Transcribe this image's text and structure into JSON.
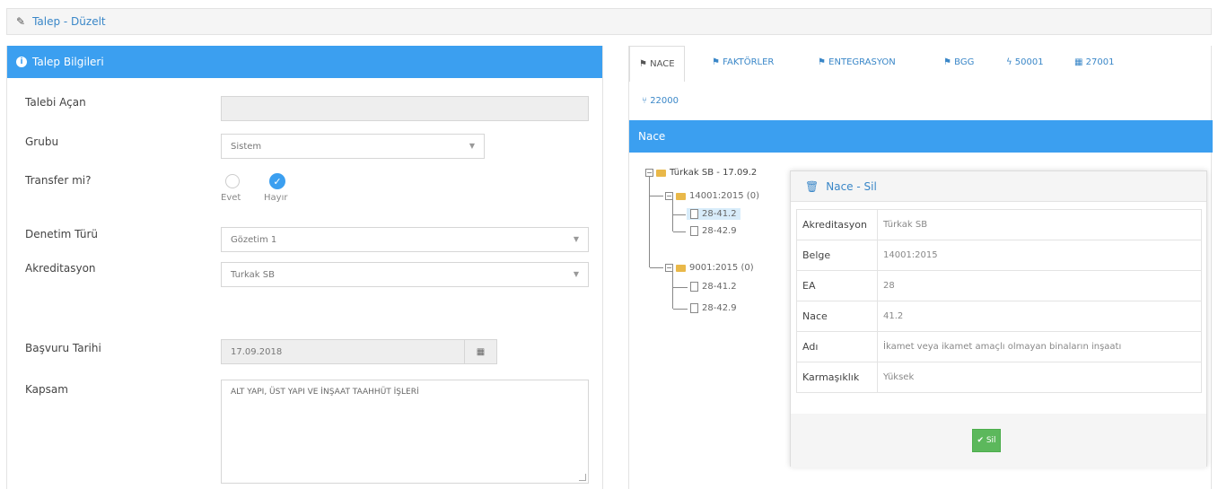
{
  "header": {
    "title": "Talep - Düzelt",
    "icon": "pencil-icon"
  },
  "left_panel": {
    "title": "Talep Bilgileri",
    "fields": {
      "talebi_acan": {
        "label": "Talebi Açan",
        "value": ""
      },
      "grubu": {
        "label": "Grubu",
        "value": "Sistem"
      },
      "transfer": {
        "label": "Transfer mi?",
        "option_yes": "Evet",
        "option_no": "Hayır",
        "selected": "Hayır"
      },
      "denetim_turu": {
        "label": "Denetim Türü",
        "value": "Gözetim 1"
      },
      "akreditasyon": {
        "label": "Akreditasyon",
        "value": "Turkak SB"
      },
      "basvuru_tarihi": {
        "label": "Başvuru Tarihi",
        "value": "17.09.2018"
      },
      "kapsam": {
        "label": "Kapsam",
        "value": "ALT YAPI, ÜST YAPI VE İNŞAAT TAAHHÜT İŞLERİ"
      }
    }
  },
  "right_panel": {
    "tabs": [
      {
        "label": "NACE",
        "active": true
      },
      {
        "label": "FAKTÖRLER"
      },
      {
        "label": "ENTEGRASYON"
      },
      {
        "label": "BGG"
      },
      {
        "label": "50001"
      },
      {
        "label": "27001"
      },
      {
        "label": "22000"
      }
    ],
    "section_title": "Nace",
    "tree": {
      "root": "Türkak SB - 17.09.2",
      "groups": [
        {
          "label": "14001:2015 (0)",
          "items": [
            "28-41.2",
            "28-42.9"
          ]
        },
        {
          "label": "9001:2015 (0)",
          "items": [
            "28-41.2",
            "28-42.9"
          ]
        }
      ]
    }
  },
  "modal": {
    "title": "Nace - Sil",
    "rows": [
      {
        "key": "Akreditasyon",
        "value": "Türkak SB"
      },
      {
        "key": "Belge",
        "value": "14001:2015"
      },
      {
        "key": "EA",
        "value": "28"
      },
      {
        "key": "Nace",
        "value": "41.2"
      },
      {
        "key": "Adı",
        "value": "İkamet veya ikamet amaçlı olmayan binaların inşaatı"
      },
      {
        "key": "Karmaşıklık",
        "value": "Yüksek"
      }
    ],
    "delete_label": "Sil"
  },
  "colors": {
    "accent": "#3b9ff0",
    "link": "#3a87c8",
    "success": "#5cb85c",
    "folder": "#e9b849"
  }
}
